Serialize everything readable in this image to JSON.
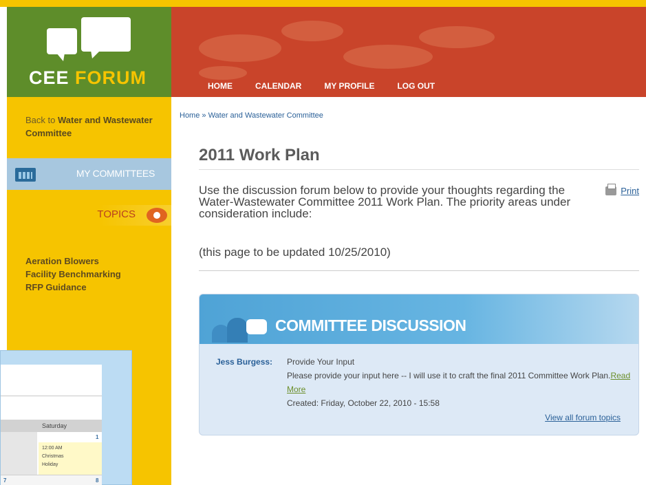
{
  "brand": {
    "name_part1": "CEE",
    "name_part2": "FORUM"
  },
  "nav": [
    "HOME",
    "CALENDAR",
    "MY PROFILE",
    "LOG OUT"
  ],
  "sidebar": {
    "back_prefix": "Back to",
    "back_link": "Water and Wastewater Committee",
    "my_committees": "MY COMMITTEES",
    "topics_label": "TOPICS",
    "topics": [
      "Aeration Blowers",
      "Facility Benchmarking",
      "RFP Guidance"
    ]
  },
  "breadcrumb": "Home » Water and Wastewater Committee",
  "page": {
    "title": "2011 Work Plan",
    "intro": "Use the discussion forum below to provide your thoughts regarding the Water-Wastewater Committee 2011 Work Plan. The priority areas under consideration include:",
    "print": "Print",
    "update_note": "(this page to be updated 10/25/2010)"
  },
  "discussion": {
    "heading": "COMMITTEE DISCUSSION",
    "author": "Jess Burgess:",
    "subject": "Provide Your Input",
    "body": "Please provide your input here -- I will use it to craft the final 2011 Committee Work Plan.",
    "read_more": "Read More",
    "created": "Created: Friday, October 22, 2010 - 15:58",
    "view_all": "View all forum topics"
  },
  "calendar_overlay": {
    "day_header": "Saturday",
    "day1": "1",
    "event_time": "12:00 AM",
    "event_line1": "Christmas",
    "event_line2": "Holiday",
    "day7": "7",
    "day8": "8"
  },
  "colors": {
    "logo_green": "#5e8d2a",
    "header_red": "#c9442a",
    "sidebar_yellow": "#f6c400",
    "link_blue": "#2a6098"
  }
}
